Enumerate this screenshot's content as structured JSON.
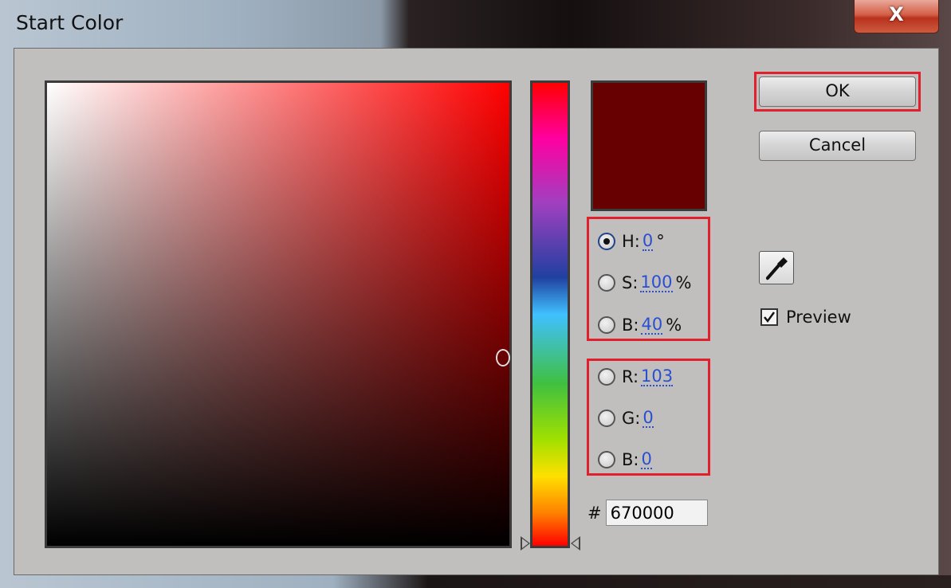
{
  "window": {
    "title": "Start Color",
    "close_label": "X"
  },
  "current_color": "#670000",
  "hsb": {
    "h": {
      "label": "H:",
      "value": "0",
      "unit": "°",
      "selected": true
    },
    "s": {
      "label": "S:",
      "value": "100",
      "unit": "%",
      "selected": false
    },
    "b": {
      "label": "B:",
      "value": "40",
      "unit": "%",
      "selected": false
    }
  },
  "rgb": {
    "r": {
      "label": "R:",
      "value": "103",
      "selected": false
    },
    "g": {
      "label": "G:",
      "value": "0",
      "selected": false
    },
    "b": {
      "label": "B:",
      "value": "0",
      "selected": false
    }
  },
  "hex": {
    "prefix": "#",
    "value": "670000"
  },
  "buttons": {
    "ok": "OK",
    "cancel": "Cancel"
  },
  "preview": {
    "label": "Preview",
    "checked": true
  },
  "icons": {
    "close": "close-icon",
    "eyedropper": "eyedropper-icon"
  },
  "highlight_color": "#e0202c"
}
